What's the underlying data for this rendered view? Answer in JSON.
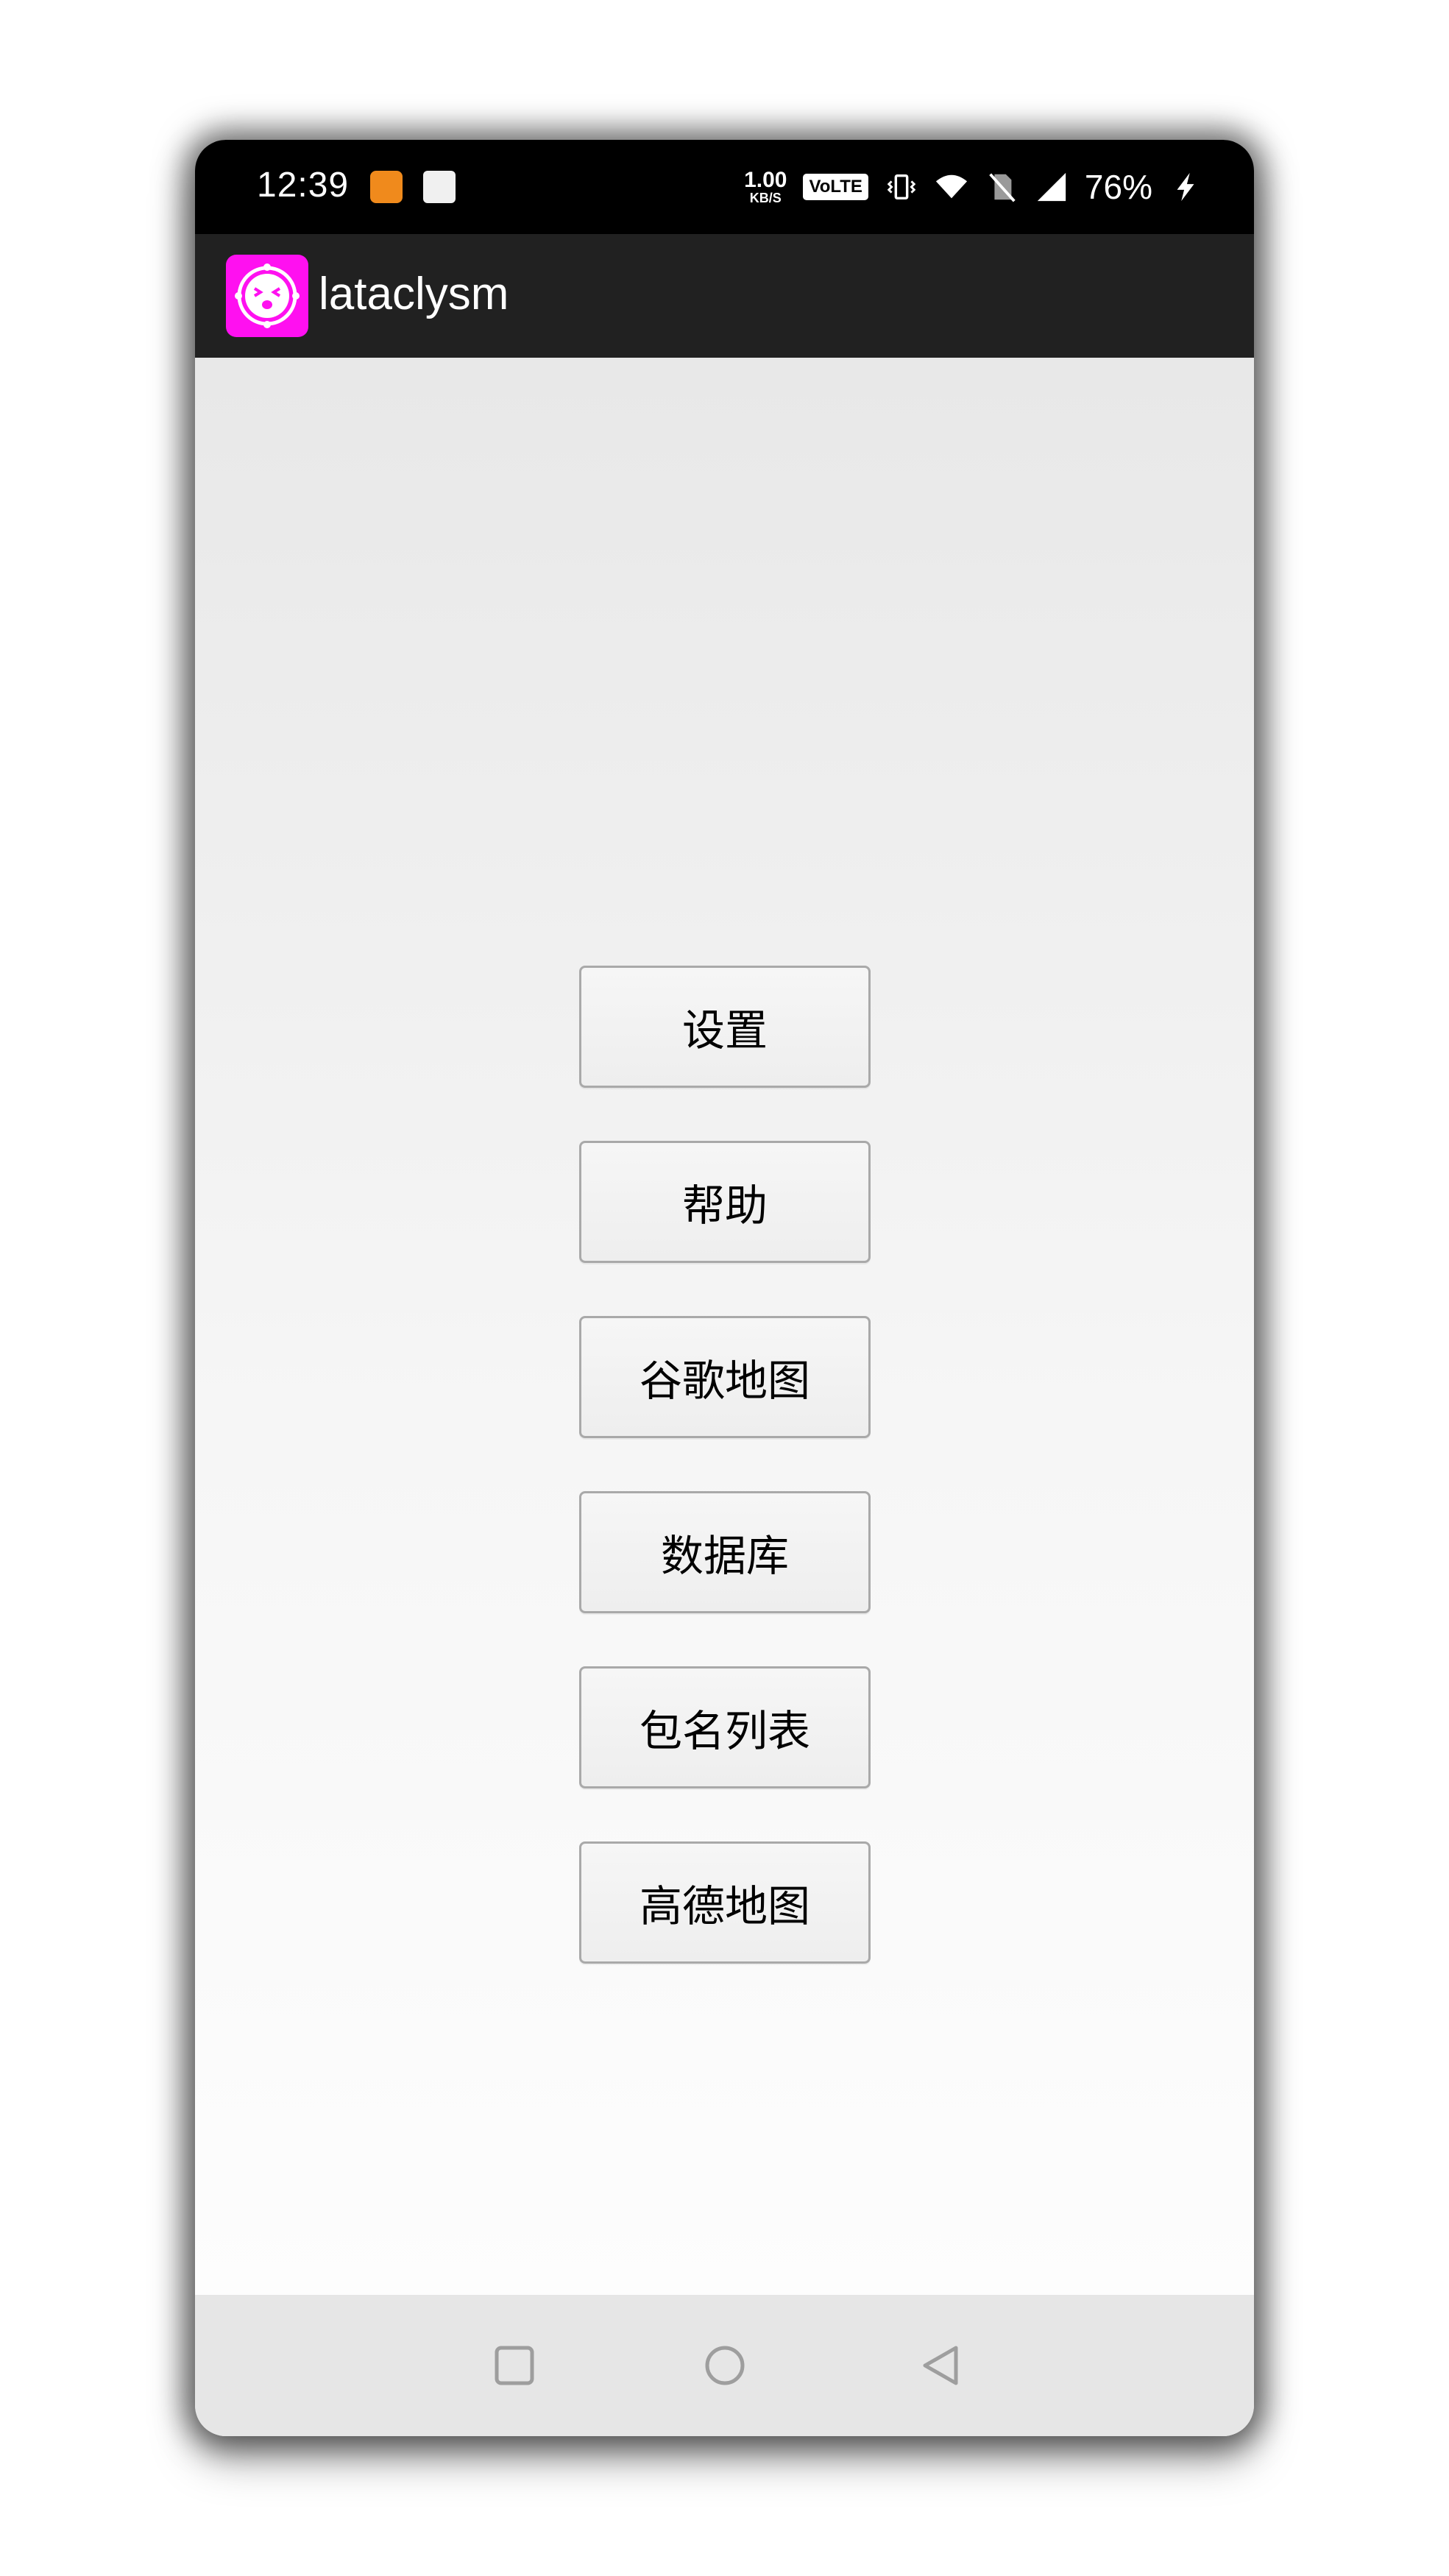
{
  "status_bar": {
    "time": "12:39",
    "net_speed_value": "1.00",
    "net_speed_unit": "KB/S",
    "volte": "VoLTE",
    "battery_percent": "76%",
    "icons": [
      "uc-browser-icon",
      "shopping-bag-icon",
      "vibrate-icon",
      "wifi-icon",
      "no-sim-icon",
      "signal-icon",
      "charging-icon"
    ]
  },
  "app_bar": {
    "title": "lataclysm",
    "logo_color": "#ff10f0"
  },
  "menu": {
    "buttons": [
      {
        "label": "设置"
      },
      {
        "label": "帮助"
      },
      {
        "label": "谷歌地图"
      },
      {
        "label": "数据库"
      },
      {
        "label": "包名列表"
      },
      {
        "label": "高德地图"
      }
    ]
  },
  "nav_bar": {
    "icons": [
      "recents-square-icon",
      "home-circle-icon",
      "back-triangle-icon"
    ]
  }
}
